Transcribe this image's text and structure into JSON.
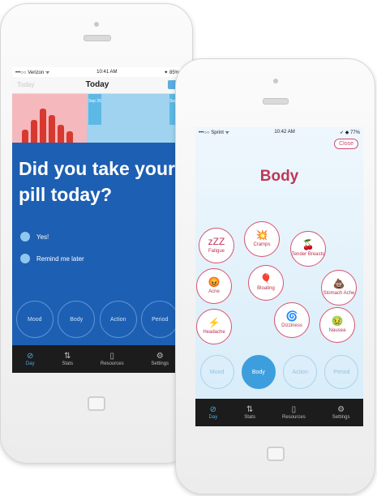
{
  "back_phone": {
    "status": {
      "carrier": "•••○○ Verizon ᯤ",
      "time": "10:41 AM",
      "battery": "✦ 85%"
    },
    "nav": {
      "left": "Today",
      "title": "Today"
    },
    "days": [
      "Sep 26",
      "Sep 27"
    ],
    "question": "Did you take your pill today?",
    "options": [
      "Yes!",
      "Remind me later"
    ],
    "circles": [
      "Mood",
      "Body",
      "Action",
      "Period"
    ],
    "tabs": [
      {
        "label": "Day",
        "icon": "clock-icon"
      },
      {
        "label": "Stats",
        "icon": "stats-icon"
      },
      {
        "label": "Resources",
        "icon": "book-icon"
      },
      {
        "label": "Settings",
        "icon": "gear-icon"
      }
    ]
  },
  "front_phone": {
    "status": {
      "carrier": "•••○○ Sprint ᯤ",
      "time": "10:42 AM",
      "battery": "➶ ◆ 77%"
    },
    "close_label": "Close",
    "title": "Body",
    "symptoms": [
      {
        "label": "Fatigue",
        "icon": "zZZ"
      },
      {
        "label": "Cramps",
        "icon": "💥"
      },
      {
        "label": "Tender Breasts",
        "icon": "🍒"
      },
      {
        "label": "Acne",
        "icon": "😡"
      },
      {
        "label": "Bloating",
        "icon": "🎈"
      },
      {
        "label": "Stomach Ache",
        "icon": "💩"
      },
      {
        "label": "Headache",
        "icon": "⚡"
      },
      {
        "label": "Dizziness",
        "icon": "🌀"
      },
      {
        "label": "Nausea",
        "icon": "🤢"
      }
    ],
    "circles": [
      "Mood",
      "Body",
      "Action",
      "Period"
    ],
    "active_circle": "Body",
    "tabs": [
      {
        "label": "Day",
        "icon": "clock-icon"
      },
      {
        "label": "Stats",
        "icon": "stats-icon"
      },
      {
        "label": "Resources",
        "icon": "book-icon"
      },
      {
        "label": "Settings",
        "icon": "gear-icon"
      }
    ]
  },
  "colors": {
    "accent_blue": "#1d5fb3",
    "accent_pink": "#c03658",
    "tab_active": "#4ea9e2"
  }
}
